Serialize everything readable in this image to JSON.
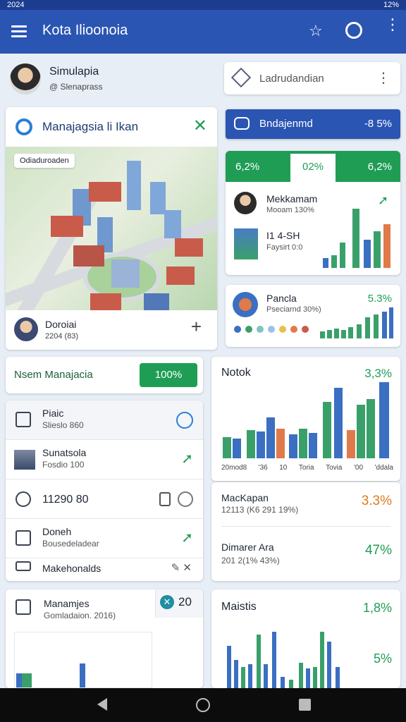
{
  "status": {
    "time": "2024",
    "battery": "12%"
  },
  "appbar": {
    "title": "Kota Ilioonoia"
  },
  "profile": {
    "name": "Simulapia",
    "sub": "@ Slenaprass"
  },
  "search": {
    "label": "Ladrudandian"
  },
  "map_card": {
    "title": "Manajagsia li Ikan",
    "map_badge": "Odiaduroaden",
    "footer_name": "Doroiai",
    "footer_sub": "2204 (83)"
  },
  "blue_button": {
    "label": "Bndajenmd",
    "value": "-8 5%"
  },
  "stats_tabs": [
    "6,2%",
    "02%",
    "6,2%"
  ],
  "stat_card1": {
    "row1": {
      "name": "Mekkamam",
      "sub": "Mooam 130%"
    },
    "row2": {
      "name": "I1 4-SH",
      "sub": "Faysirt 0:0"
    }
  },
  "stat_card2": {
    "name": "Pancla",
    "sub": "Pseciarnd 30%)",
    "pct": "5.3%"
  },
  "manage_bar": {
    "label": "Nsem Manajacia",
    "button": "100%"
  },
  "list": [
    {
      "title": "Piaic",
      "sub": "Slieslo 860"
    },
    {
      "title": "Sunatsola",
      "sub": "Fosdio 100"
    },
    {
      "title": "11290 80",
      "sub": ""
    },
    {
      "title": "Doneh",
      "sub": "Bousedeladear"
    },
    {
      "title": "Makehonalds",
      "sub": ""
    }
  ],
  "notok": {
    "title": "Notok",
    "pct": "3,3%",
    "labels": [
      "20mod8",
      "'36",
      "10",
      "Toria",
      "Tovia",
      "'00",
      "'ddala"
    ]
  },
  "metrics": [
    {
      "title": "MacKapan",
      "sub": "12113 (K6 291 19%)",
      "value": "3.3%"
    },
    {
      "title": "Dimarer Ara",
      "sub": "201 2(1% 43%)",
      "value": "47%"
    }
  ],
  "bottom_left": {
    "title": "Manamjes",
    "sub": "Gomladaion. 2016)",
    "badge": "20"
  },
  "bottom_right": {
    "title": "Maistis",
    "v1": "1,8%",
    "v2": "5%"
  },
  "colors": {
    "brand": "#2a55b3",
    "green": "#1f9d55",
    "orange": "#e07a1f",
    "navbar": "#0c0c0c"
  }
}
